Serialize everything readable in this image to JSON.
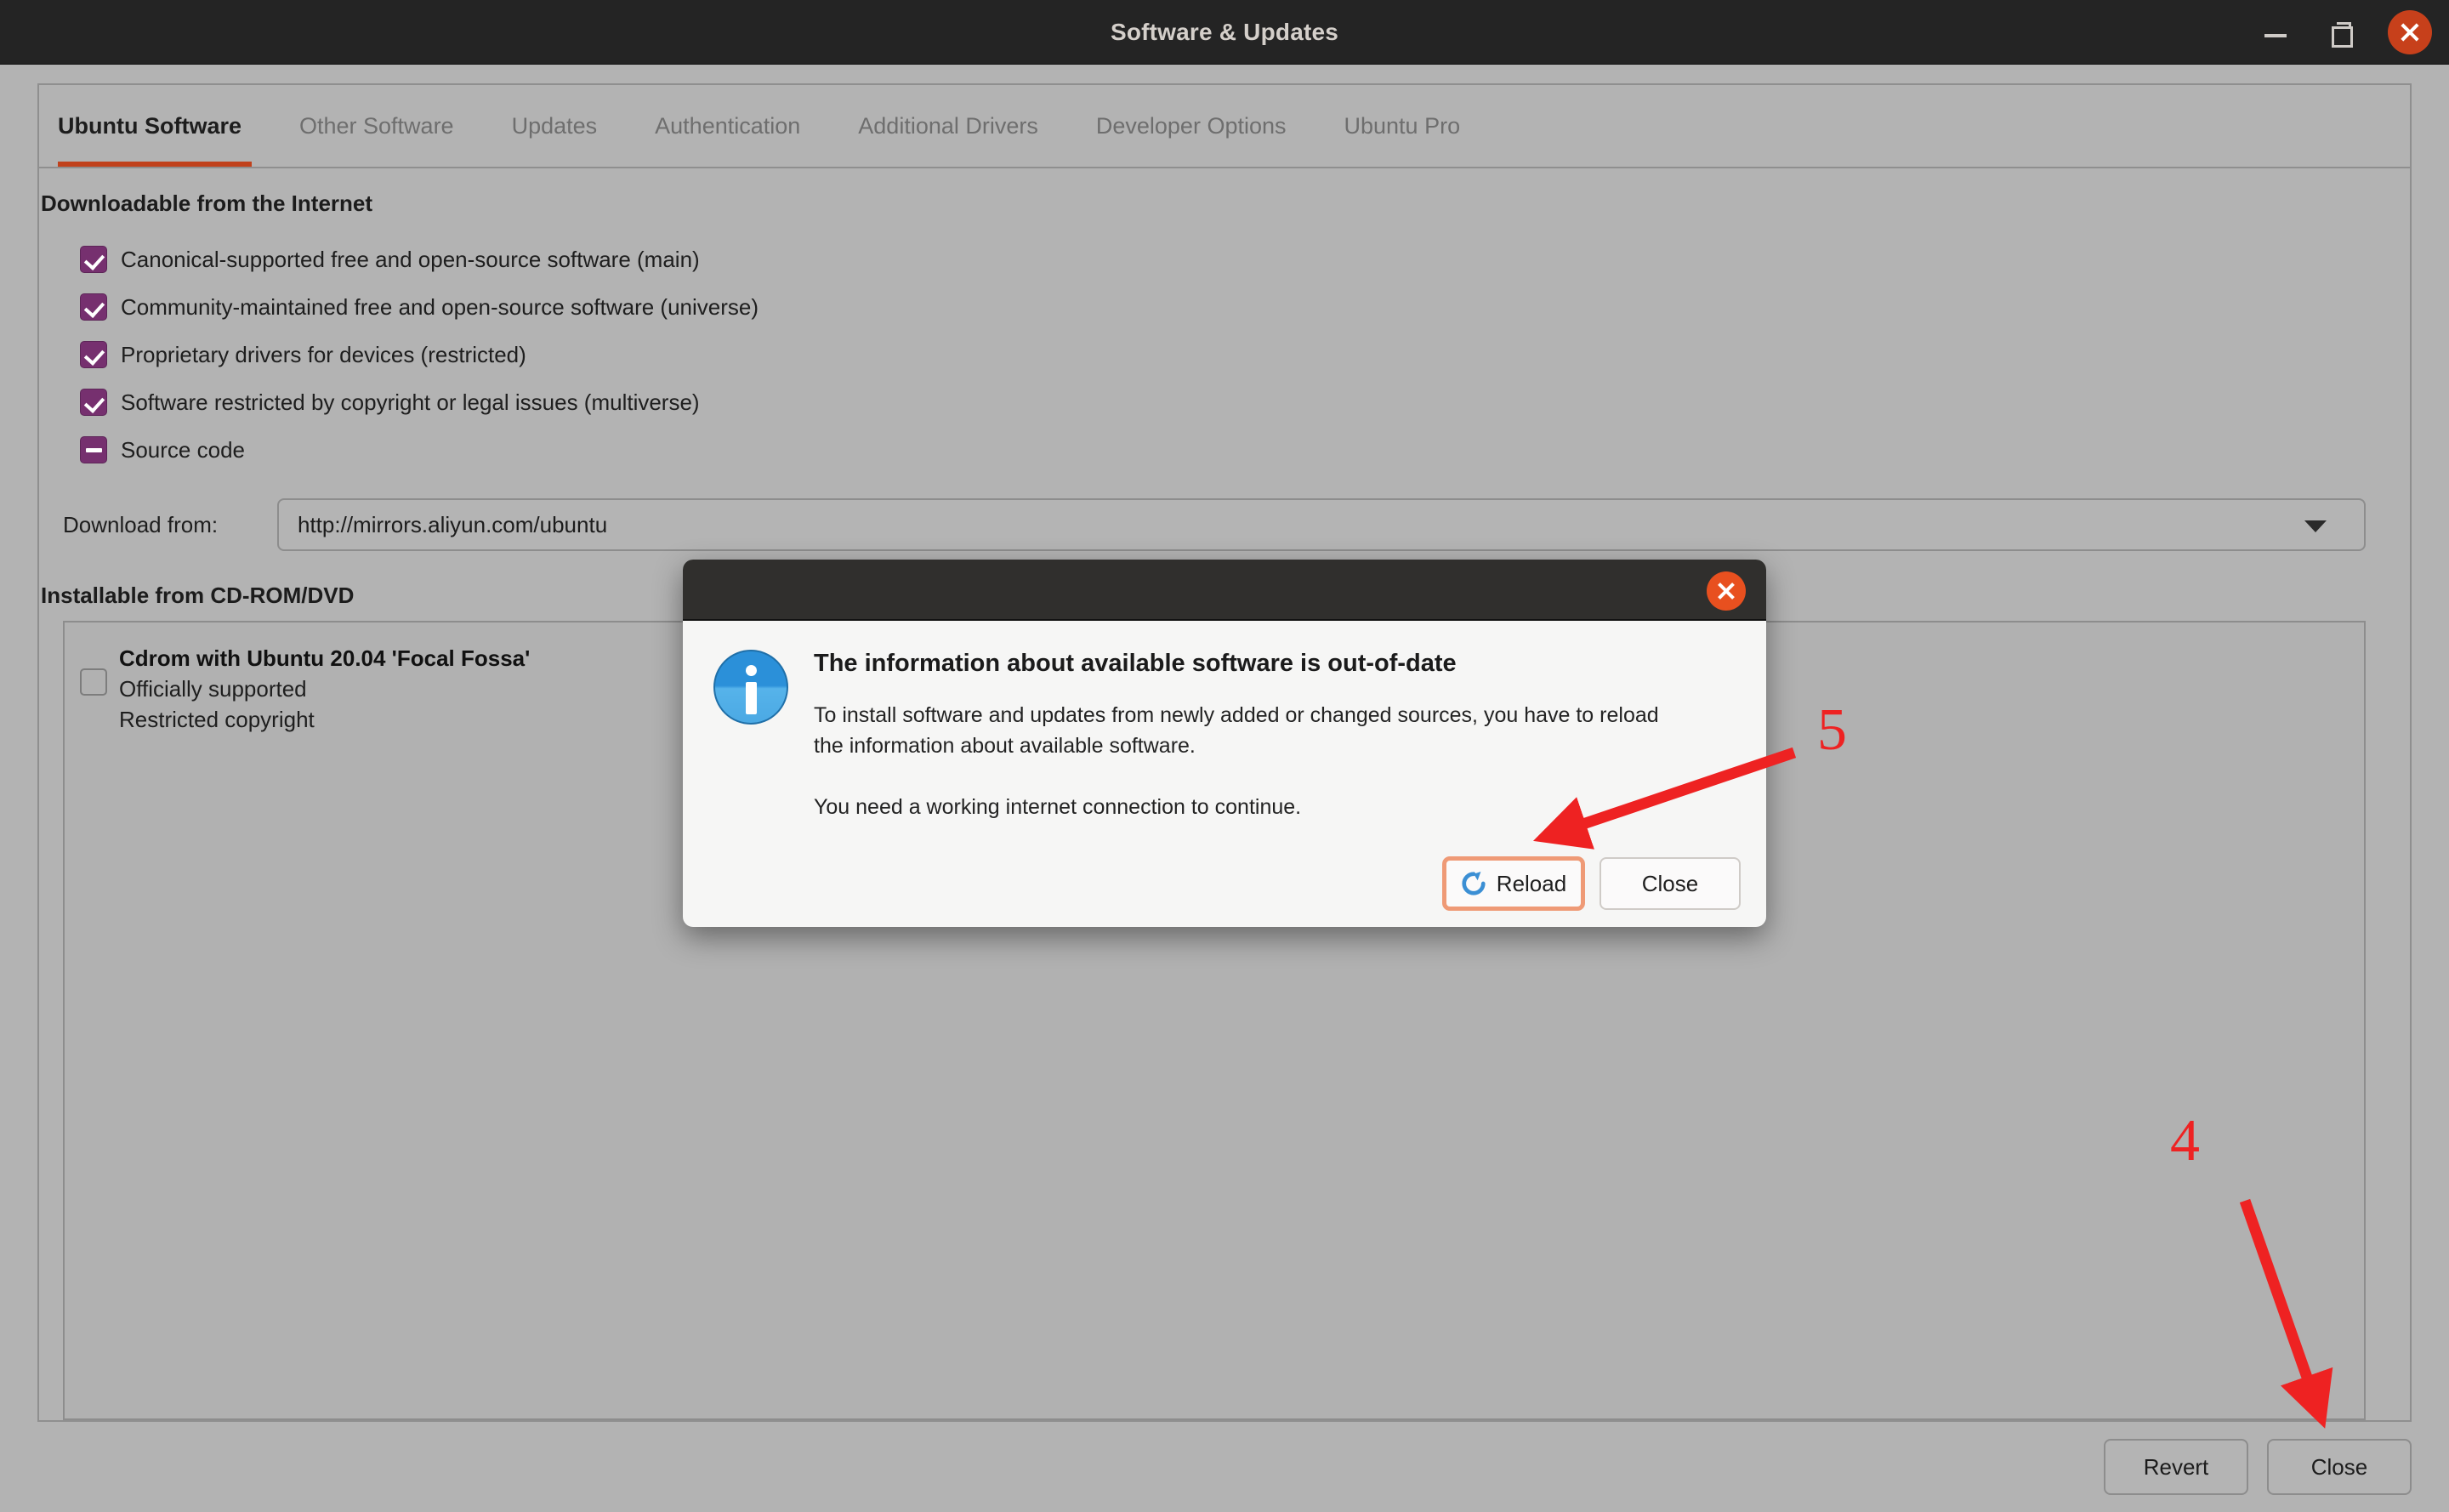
{
  "window": {
    "title": "Software & Updates",
    "controls": {
      "minimize": "minimize-icon",
      "maximize": "maximize-icon",
      "close": "close-icon"
    }
  },
  "tabs": [
    {
      "label": "Ubuntu Software",
      "active": true
    },
    {
      "label": "Other Software",
      "active": false
    },
    {
      "label": "Updates",
      "active": false
    },
    {
      "label": "Authentication",
      "active": false
    },
    {
      "label": "Additional Drivers",
      "active": false
    },
    {
      "label": "Developer Options",
      "active": false
    },
    {
      "label": "Ubuntu Pro",
      "active": false
    }
  ],
  "main": {
    "internet_section_title": "Downloadable from the Internet",
    "sources": [
      {
        "label": "Canonical-supported free and open-source software (main)",
        "state": "checked"
      },
      {
        "label": "Community-maintained free and open-source software (universe)",
        "state": "checked"
      },
      {
        "label": "Proprietary drivers for devices (restricted)",
        "state": "checked"
      },
      {
        "label": "Software restricted by copyright or legal issues (multiverse)",
        "state": "checked"
      },
      {
        "label": "Source code",
        "state": "mixed"
      }
    ],
    "download_from_label": "Download from:",
    "download_from_value": "http://mirrors.aliyun.com/ubuntu",
    "cdrom_section_title": "Installable from CD-ROM/DVD",
    "cdrom_item": {
      "state": "empty",
      "line1": "Cdrom with Ubuntu 20.04 'Focal Fossa'",
      "line2": "Officially supported",
      "line3": "Restricted copyright"
    }
  },
  "actionbar": {
    "revert_label": "Revert",
    "close_label": "Close"
  },
  "dialog": {
    "heading": "The information about available software is out-of-date",
    "paragraph1": "To install software and updates from newly added or changed sources, you have to reload the information about available software.",
    "paragraph2": "You need a working internet connection to continue.",
    "reload_label": "Reload",
    "close_label": "Close",
    "info_icon": "info-icon",
    "close_icon": "close-icon"
  },
  "annotations": [
    {
      "number": "5"
    },
    {
      "number": "4"
    }
  ],
  "colors": {
    "accent_orange": "#c0411c",
    "checkbox_purple": "#76306f",
    "annotation_red": "#ee2222",
    "focus_ring": "#ef9a76",
    "info_blue": "#2b90d9"
  }
}
